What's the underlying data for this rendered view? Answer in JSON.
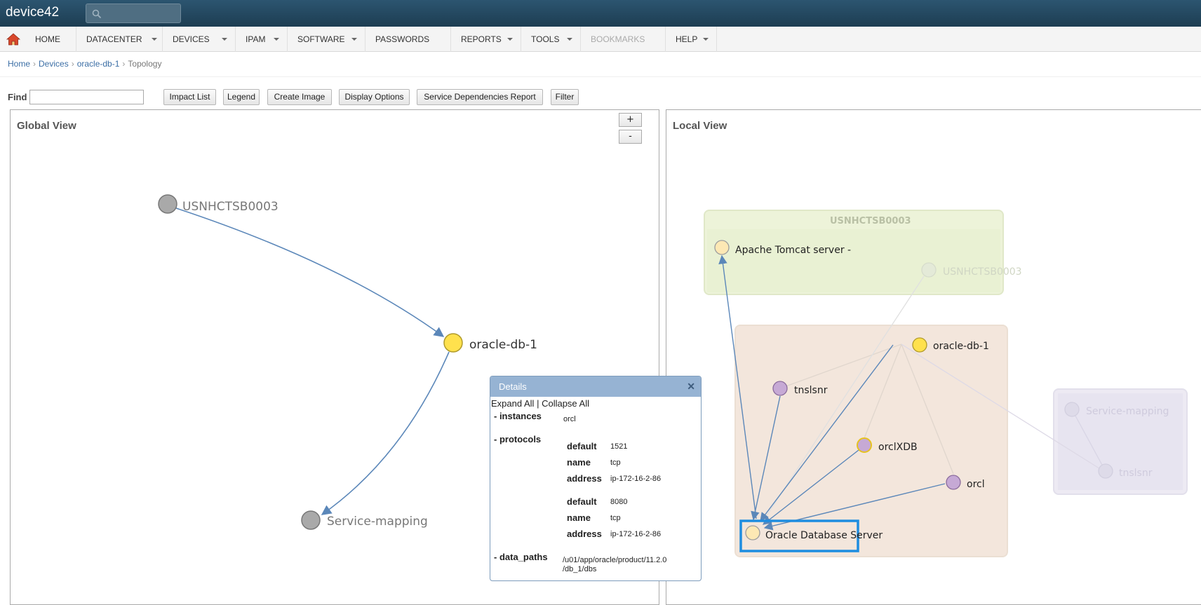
{
  "app": {
    "brand": "device42",
    "search_icon": "search-icon"
  },
  "nav": {
    "home_icon": "home-icon",
    "items": [
      {
        "label": "HOME"
      },
      {
        "label": "DATACENTER"
      },
      {
        "label": "DEVICES"
      },
      {
        "label": "IPAM"
      },
      {
        "label": "SOFTWARE"
      },
      {
        "label": "PASSWORDS"
      },
      {
        "label": "REPORTS"
      },
      {
        "label": "TOOLS"
      },
      {
        "label": "BOOKMARKS"
      },
      {
        "label": "HELP"
      }
    ]
  },
  "breadcrumb": {
    "home": "Home",
    "devices": "Devices",
    "device": "oracle-db-1",
    "current": "Topology",
    "separator": "›"
  },
  "toolbar": {
    "find_label": "Find",
    "find_value": "",
    "buttons": [
      "Impact List",
      "Legend",
      "Create Image",
      "Display Options",
      "Service Dependencies Report",
      "Filter"
    ]
  },
  "global_view": {
    "title": "Global View",
    "zoom_in": "+",
    "zoom_out": "-",
    "nodes": {
      "usn": "USNHCTSB0003",
      "oracle": "oracle-db-1",
      "service": "Service-mapping"
    }
  },
  "local_view": {
    "title": "Local View",
    "groups": {
      "usn": "USNHCTSB0003"
    },
    "nodes": {
      "tomcat": "Apache Tomcat server -",
      "usn_faded": "USNHCTSB0003",
      "oracle": "oracle-db-1",
      "tnslsnr": "tnslsnr",
      "orclxdb": "orclXDB",
      "orcl": "orcl",
      "oracle_server": "Oracle Database Server",
      "service_faded": "Service-mapping",
      "tnslsnr_faded": "tnslsnr"
    }
  },
  "details": {
    "title": "Details",
    "close_icon": "close-icon",
    "expand_all": "Expand All",
    "separator": "|",
    "collapse_all": "Collapse All",
    "instances_label": "- instances",
    "instances_value": "orcl",
    "protocols_label": "- protocols",
    "protocol_1": {
      "default_label": "default",
      "default": "1521",
      "name_label": "name",
      "name": "tcp",
      "address_label": "address",
      "address": "ip-172-16-2-86"
    },
    "protocol_2": {
      "default_label": "default",
      "default": "8080",
      "name_label": "name",
      "name": "tcp",
      "address_label": "address",
      "address": "ip-172-16-2-86"
    },
    "data_paths_label": "- data_paths",
    "data_paths_line1": "/u01/app/oracle/product/11.2.0",
    "data_paths_line2": "/db_1/dbs"
  },
  "colors": {
    "edge": "#5b87b9",
    "node_gray": "#a9a9a9",
    "node_yellow": "#ffe14d",
    "node_cream": "#fde8b4",
    "node_purple": "#c6a9d5",
    "highlight": "#1e8de0"
  }
}
